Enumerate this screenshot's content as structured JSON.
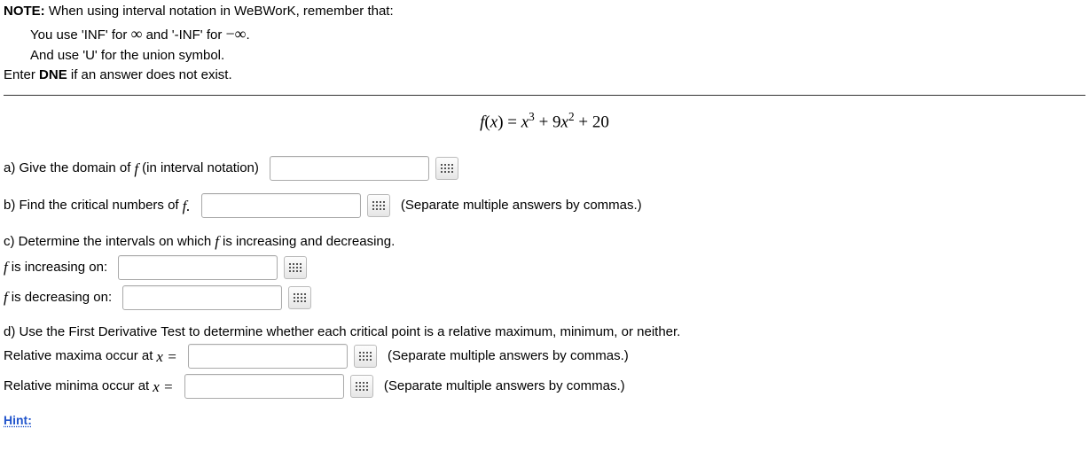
{
  "note": {
    "label": "NOTE:",
    "line1a": " When using interval notation in WeBWorK, remember that:",
    "line2a": "You use 'INF' for ",
    "line2b": " and '-INF' for ",
    "line2c": ".",
    "line3": "And use 'U' for the union symbol.",
    "line4a": "Enter ",
    "line4b": "DNE",
    "line4c": " if an answer does not exist."
  },
  "inf_sym": "∞",
  "neg_inf_sym": "−∞",
  "formula_lhs": "f(x) = ",
  "formula_rhs_core": "x³ + 9x² + 20",
  "a": {
    "prompt_pre": "a) Give the domain of ",
    "f": "f",
    "prompt_post": " (in interval notation)"
  },
  "b": {
    "prompt_pre": "b) Find the critical numbers of ",
    "f": "f.",
    "after": "(Separate multiple answers by commas.)"
  },
  "c": {
    "prompt_pre": "c) Determine the intervals on which ",
    "f": "f",
    "prompt_post": " is increasing and decreasing.",
    "inc_pre": "f",
    "inc_post": " is increasing on:",
    "dec_pre": "f",
    "dec_post": " is decreasing on:"
  },
  "d": {
    "prompt": "d) Use the First Derivative Test to determine whether each critical point is a relative maximum, minimum, or neither.",
    "max_pre": "Relative maxima occur at ",
    "xeq": "x =",
    "after1": "(Separate multiple answers by commas.)",
    "min_pre": "Relative minima occur at ",
    "after2": "(Separate multiple answers by commas.)"
  },
  "hint": "Hint:"
}
